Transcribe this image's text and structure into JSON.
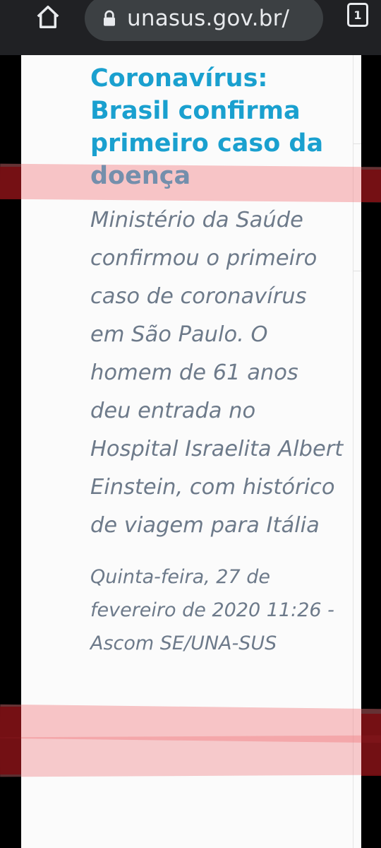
{
  "browser": {
    "url": "unasus.gov.br/",
    "tab_count": "1",
    "icons": {
      "home": "home-icon",
      "lock": "lock-icon",
      "tabs": "tab-switcher-icon"
    }
  },
  "article": {
    "title": "Coronavírus: Brasil confirma primeiro caso da doença",
    "summary": "Ministério da Saúde confirmou o primeiro caso de coronavírus em São Paulo. O homem de 61 anos deu entrada no Hospital Israelita Albert Einstein, com histórico de viagem para Itália",
    "meta": "Quinta-feira, 27 de fevereiro de 2020 11:26 - Ascom SE/UNA-SUS"
  },
  "colors": {
    "title": "#1aa0cf",
    "body_text": "#6d7a8a",
    "highlight": "#f0787d",
    "browser_bar": "#202124",
    "url_bar": "#3c4043"
  }
}
